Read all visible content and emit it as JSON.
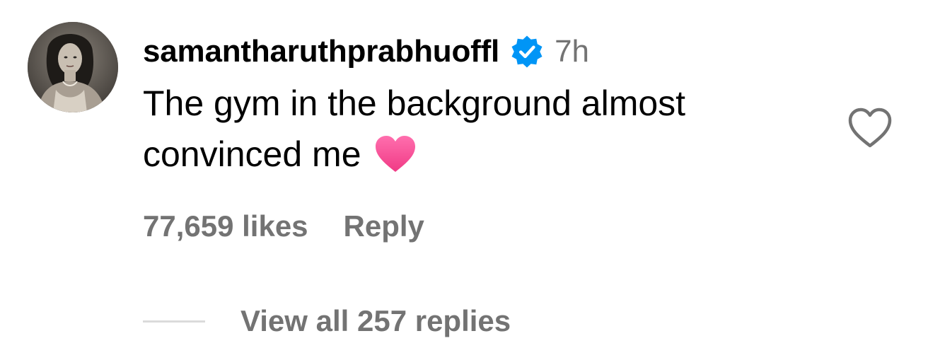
{
  "comment": {
    "avatar_icon": "profile-photo",
    "username": "samantharuthprabhuoffl",
    "verified_icon": "verified-badge-icon",
    "verified_color": "#0095F6",
    "timestamp": "7h",
    "text": "The gym in the background almost convinced me",
    "emoji_icon": "pink-heart-emoji",
    "emoji_color": "#F7418F",
    "likes": "77,659 likes",
    "reply_label": "Reply",
    "like_icon": "heart-outline-icon",
    "view_replies_label": "View all 257 replies"
  }
}
